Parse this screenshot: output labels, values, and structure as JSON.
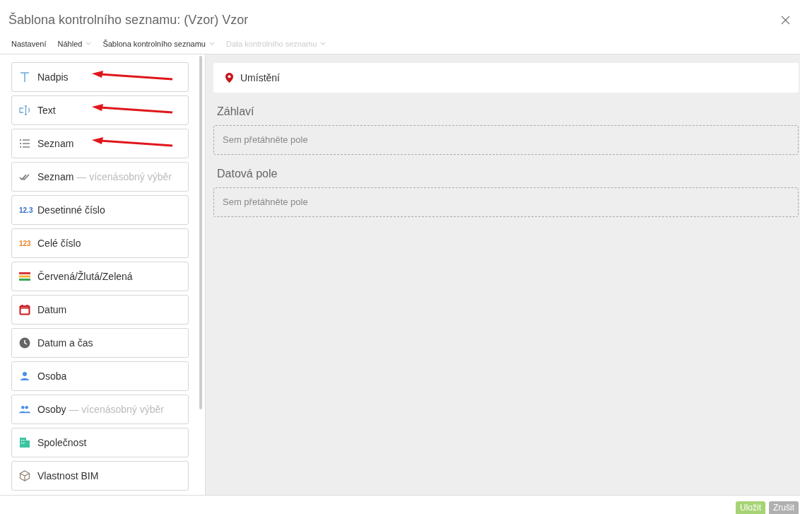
{
  "window": {
    "title": "Šablona kontrolního seznamu: (Vzor) Vzor"
  },
  "menu": [
    {
      "label": "Nastavení",
      "dropdown": false,
      "disabled": false
    },
    {
      "label": "Náhled",
      "dropdown": true,
      "disabled": false
    },
    {
      "label": "Šablona kontrolního seznamu",
      "dropdown": true,
      "disabled": false
    },
    {
      "label": "Data kontrolního seznamu",
      "dropdown": true,
      "disabled": true
    }
  ],
  "fields": [
    {
      "kind": "heading",
      "label": "Nadpis",
      "arrow": true
    },
    {
      "kind": "text",
      "label": "Text",
      "arrow": true
    },
    {
      "kind": "list",
      "label": "Seznam",
      "arrow": true
    },
    {
      "kind": "multilist",
      "label": "Seznam",
      "note": "— vícenásobný výběr",
      "arrow": false
    },
    {
      "kind": "decimal",
      "label": "Desetinné číslo",
      "icon_text": "12.3",
      "arrow": false
    },
    {
      "kind": "integer",
      "label": "Celé číslo",
      "icon_text": "123",
      "arrow": false
    },
    {
      "kind": "traffic",
      "label": "Červená/Žlutá/Zelená",
      "arrow": false
    },
    {
      "kind": "date",
      "label": "Datum",
      "arrow": false
    },
    {
      "kind": "datetime",
      "label": "Datum a čas",
      "arrow": false
    },
    {
      "kind": "person",
      "label": "Osoba",
      "arrow": false
    },
    {
      "kind": "persons",
      "label": "Osoby",
      "note": "— vícenásobný výběr",
      "arrow": false
    },
    {
      "kind": "company",
      "label": "Společnost",
      "arrow": false
    },
    {
      "kind": "bim",
      "label": "Vlastnost BIM",
      "arrow": false
    }
  ],
  "location": {
    "label": "Umístění"
  },
  "sections": [
    {
      "title": "Záhlaví",
      "placeholder": "Sem přetáhněte pole"
    },
    {
      "title": "Datová pole",
      "placeholder": "Sem přetáhněte pole"
    }
  ],
  "buttons": [
    {
      "label": "Uložit",
      "kind": "primary"
    },
    {
      "label": "Zrušit",
      "kind": "secondary"
    }
  ]
}
